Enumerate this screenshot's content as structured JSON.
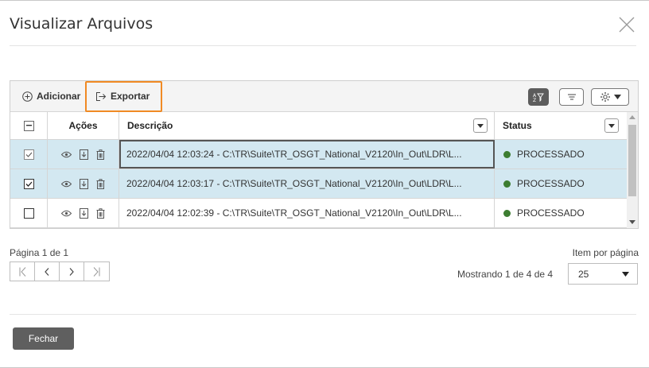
{
  "dialog": {
    "title": "Visualizar Arquivos",
    "close_icon": "close-icon"
  },
  "toolbar": {
    "add_label": "Adicionar",
    "export_label": "Exportar",
    "icons": [
      "sort-filter-icon",
      "list-icon",
      "gear-icon"
    ]
  },
  "table": {
    "columns": {
      "actions": "Ações",
      "description": "Descrição",
      "status": "Status"
    },
    "rows": [
      {
        "checked": true,
        "selected": true,
        "description": "2022/04/04 12:03:24 - C:\\TR\\Suite\\TR_OSGT_National_V2120\\In_Out\\LDR\\L...",
        "status": "PROCESSADO",
        "status_color": "#3d7d31"
      },
      {
        "checked": true,
        "selected": true,
        "description": "2022/04/04 12:03:17 - C:\\TR\\Suite\\TR_OSGT_National_V2120\\In_Out\\LDR\\L...",
        "status": "PROCESSADO",
        "status_color": "#3d7d31"
      },
      {
        "checked": false,
        "selected": false,
        "description": "2022/04/04 12:02:39 - C:\\TR\\Suite\\TR_OSGT_National_V2120\\In_Out\\LDR\\L...",
        "status": "PROCESSADO",
        "status_color": "#3d7d31"
      }
    ]
  },
  "pagination": {
    "page_info": "Página 1 de 1",
    "showing": "Mostrando 1 de 4 de 4",
    "items_per_page_label": "Item por página",
    "items_per_page_value": "25"
  },
  "footer": {
    "close_label": "Fechar"
  },
  "colors": {
    "accent_focus": "#f08a24",
    "selected_row": "#d3e8f1",
    "status_processed": "#3d7d31"
  }
}
